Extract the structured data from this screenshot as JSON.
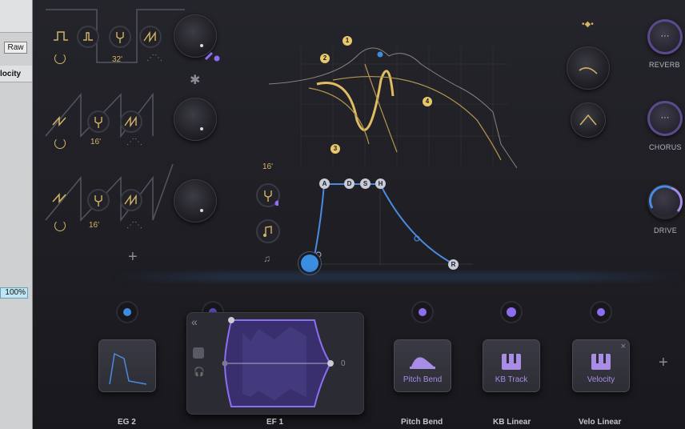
{
  "host": {
    "raw_label": "Raw",
    "velocity_label": "locity",
    "percent_value": "100%"
  },
  "oscillators": [
    {
      "octave": "32'"
    },
    {
      "octave": "16'"
    },
    {
      "octave": "16'"
    }
  ],
  "filter": {
    "octave_label": "16'",
    "points": [
      "1",
      "2",
      "3",
      "4"
    ]
  },
  "envelope": {
    "stages": [
      "A",
      "D",
      "S",
      "H"
    ],
    "release": "R"
  },
  "fx": {
    "reverb": "REVERB",
    "chorus": "CHORUS",
    "drive": "DRIVE",
    "dots": "···"
  },
  "modulation": {
    "pitch_bend": "Pitch Bend",
    "kb_track": "KB Track",
    "velocity": "Velocity",
    "ef_value": "0",
    "close": "×"
  },
  "footer": {
    "eg2": "EG 2",
    "ef1": "EF 1",
    "pitch_bend": "Pitch Bend",
    "kb_linear": "KB Linear",
    "velo_linear": "Velo Linear"
  },
  "colors": {
    "gold": "#e8c86a",
    "accent": "#8f6df0",
    "blue": "#3b8de0"
  }
}
